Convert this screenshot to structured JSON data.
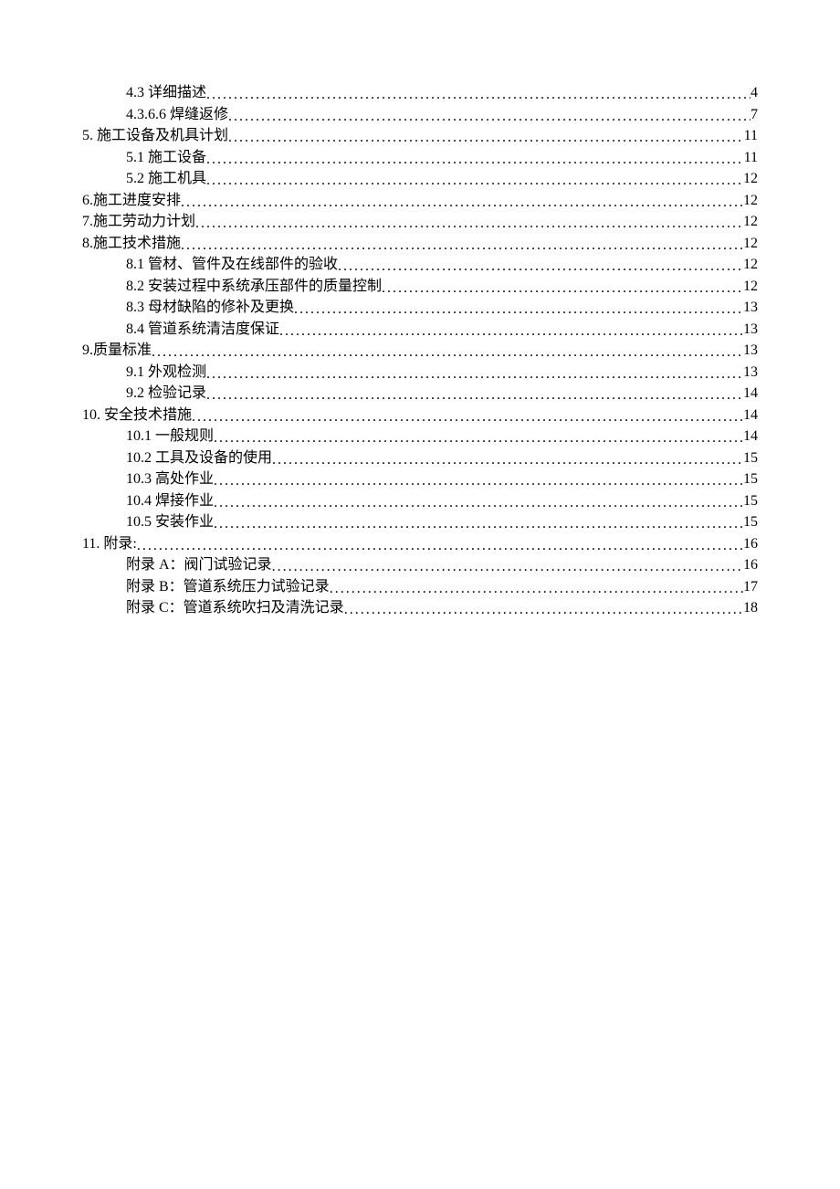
{
  "toc": [
    {
      "level": 1,
      "label": "4.3 详细描述",
      "page": "4"
    },
    {
      "level": 1,
      "label": "4.3.6.6 焊缝返修",
      "page": "7"
    },
    {
      "level": 0,
      "label": "5. 施工设备及机具计划",
      "page": "11"
    },
    {
      "level": 1,
      "label": "5.1 施工设备",
      "page": "11"
    },
    {
      "level": 1,
      "label": "5.2 施工机具",
      "page": "12"
    },
    {
      "level": 0,
      "label": "6.施工进度安排",
      "page": "12"
    },
    {
      "level": 0,
      "label": "7.施工劳动力计划",
      "page": "12"
    },
    {
      "level": 0,
      "label": "8.施工技术措施",
      "page": "12"
    },
    {
      "level": 1,
      "label": "8.1 管材、管件及在线部件的验收",
      "page": "12"
    },
    {
      "level": 1,
      "label": "8.2 安装过程中系统承压部件的质量控制",
      "page": "12"
    },
    {
      "level": 1,
      "label": "8.3 母材缺陷的修补及更换",
      "page": "13"
    },
    {
      "level": 1,
      "label": "8.4 管道系统清洁度保证",
      "page": "13"
    },
    {
      "level": 0,
      "label": "9.质量标准",
      "page": "13"
    },
    {
      "level": 1,
      "label": "9.1 外观检测",
      "page": "13"
    },
    {
      "level": 1,
      "label": "9.2 检验记录",
      "page": "14"
    },
    {
      "level": 0,
      "label": "10. 安全技术措施",
      "page": "14"
    },
    {
      "level": 1,
      "label": "10.1 一般规则",
      "page": "14"
    },
    {
      "level": 1,
      "label": "10.2 工具及设备的使用",
      "page": "15"
    },
    {
      "level": 1,
      "label": "10.3 高处作业",
      "page": "15"
    },
    {
      "level": 1,
      "label": "10.4 焊接作业",
      "page": "15"
    },
    {
      "level": 1,
      "label": "10.5 安装作业",
      "page": "15"
    },
    {
      "level": 0,
      "label": "11. 附录:",
      "page": "16"
    },
    {
      "level": 1,
      "label": "附录 A：阀门试验记录",
      "page": "16"
    },
    {
      "level": 1,
      "label": "附录 B：管道系统压力试验记录",
      "page": "17"
    },
    {
      "level": 1,
      "label": "附录 C：管道系统吹扫及清洗记录",
      "page": "18"
    }
  ]
}
